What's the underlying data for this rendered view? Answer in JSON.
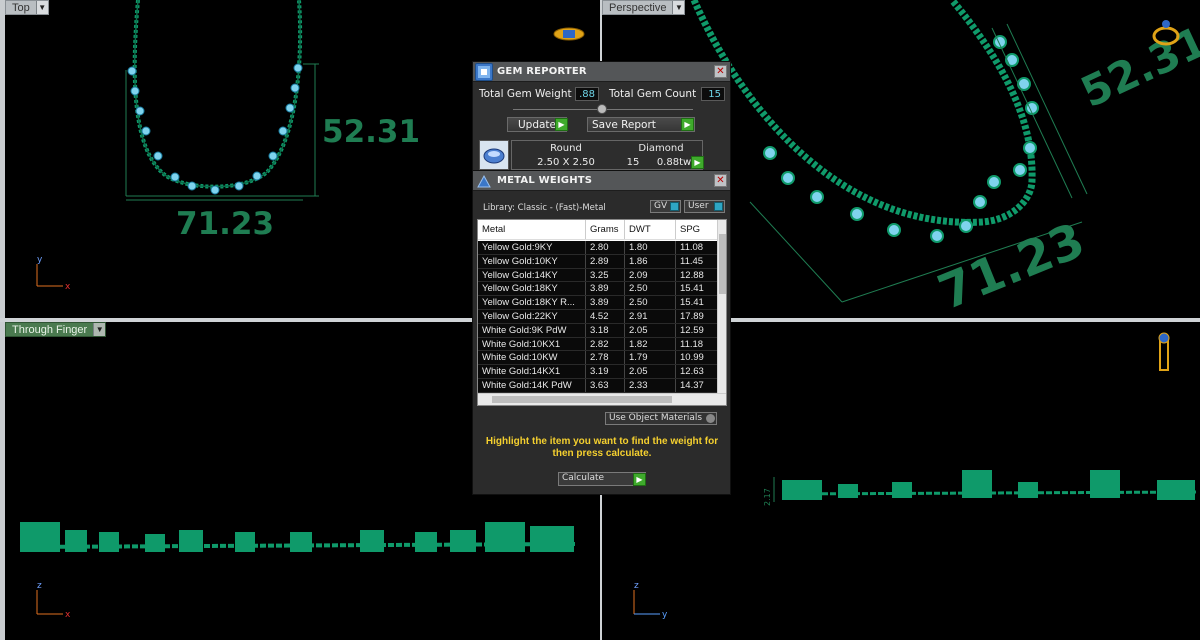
{
  "viewports": {
    "top": {
      "label": "Top"
    },
    "perspective": {
      "label": "Perspective"
    },
    "through_finger": {
      "label": "Through Finger"
    }
  },
  "dimensions": {
    "top_height": "52.31",
    "top_width": "71.23",
    "persp_height": "52.31",
    "persp_width": "71.23",
    "side_height": "2.17"
  },
  "axes": {
    "y": "y",
    "x": "x",
    "z": "z"
  },
  "gem_reporter": {
    "title": "GEM REPORTER",
    "total_weight_label": "Total Gem Weight",
    "total_weight_value": ".88",
    "total_count_label": "Total Gem Count",
    "total_count_value": "15",
    "update_label": "Update",
    "save_label": "Save Report",
    "gem": {
      "shape": "Round",
      "material": "Diamond",
      "size": "2.50 X 2.50",
      "count": "15",
      "weight": "0.88tw"
    }
  },
  "metal_weights": {
    "title": "METAL WEIGHTS",
    "library_label": "Library: Classic - (Fast)-Metal",
    "gv_label": "GV",
    "user_label": "User",
    "columns": [
      "Metal",
      "Grams",
      "DWT",
      "SPG"
    ],
    "rows": [
      [
        "Yellow Gold:9KY",
        "2.80",
        "1.80",
        "11.08"
      ],
      [
        "Yellow Gold:10KY",
        "2.89",
        "1.86",
        "11.45"
      ],
      [
        "Yellow Gold:14KY",
        "3.25",
        "2.09",
        "12.88"
      ],
      [
        "Yellow Gold:18KY",
        "3.89",
        "2.50",
        "15.41"
      ],
      [
        "Yellow Gold:18KY R...",
        "3.89",
        "2.50",
        "15.41"
      ],
      [
        "Yellow Gold:22KY",
        "4.52",
        "2.91",
        "17.89"
      ],
      [
        "White Gold:9K PdW",
        "3.18",
        "2.05",
        "12.59"
      ],
      [
        "White Gold:10KX1",
        "2.82",
        "1.82",
        "11.18"
      ],
      [
        "White Gold:10KW",
        "2.78",
        "1.79",
        "10.99"
      ],
      [
        "White Gold:14KX1",
        "3.19",
        "2.05",
        "12.63"
      ],
      [
        "White Gold:14K PdW",
        "3.63",
        "2.33",
        "14.37"
      ]
    ],
    "use_object_materials": "Use Object Materials",
    "instruction": "Highlight the item you want to find the weight for then press calculate.",
    "calculate_label": "Calculate"
  },
  "colors": {
    "metal": "#0f9a6a",
    "gem": "#7fd3ee",
    "dimension": "#1f7d52",
    "accent_gold": "#e0a317"
  }
}
